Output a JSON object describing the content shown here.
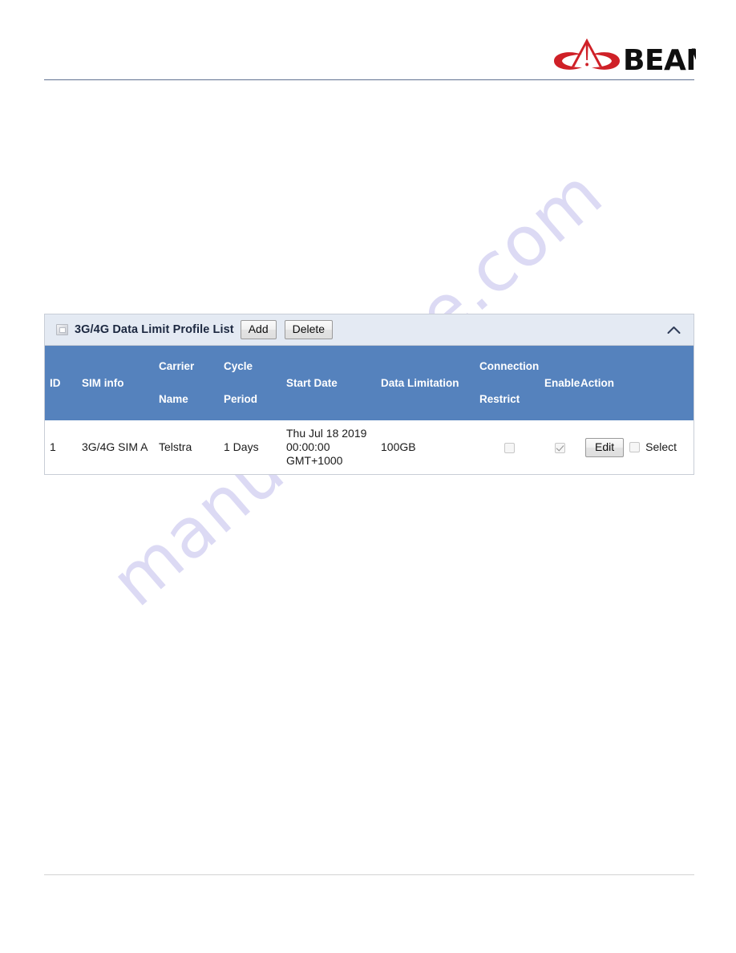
{
  "header": {
    "logo_text": "BEAM",
    "logo_mark": "beam-antenna-icon",
    "logo_trademark": "®"
  },
  "watermark": {
    "text": "manualshive.com"
  },
  "panel": {
    "icon": "minimize-box-icon",
    "title": "3G/4G Data Limit Profile List",
    "add_label": "Add",
    "delete_label": "Delete",
    "collapse_icon": "chevron-up-icon",
    "header_bg": "#e4eaf3",
    "table_header_bg": "#5582bd"
  },
  "table": {
    "columns": [
      {
        "id": "id",
        "label": "ID",
        "line1": "ID",
        "line2": ""
      },
      {
        "id": "sim_info",
        "label": "SIM info",
        "line1": "SIM info",
        "line2": ""
      },
      {
        "id": "carrier_name",
        "label": "Carrier Name",
        "line1": "Carrier",
        "line2": "Name"
      },
      {
        "id": "cycle_period",
        "label": "Cycle Period",
        "line1": "Cycle",
        "line2": "Period"
      },
      {
        "id": "start_date",
        "label": "Start Date",
        "line1": "Start Date",
        "line2": ""
      },
      {
        "id": "data_limitation",
        "label": "Data Limitation",
        "line1": "Data Limitation",
        "line2": ""
      },
      {
        "id": "connection_restrict",
        "label": "Connection Restrict",
        "line1": "Connection",
        "line2": "Restrict"
      },
      {
        "id": "enable",
        "label": "Enable",
        "line1": "Enable",
        "line2": ""
      },
      {
        "id": "action",
        "label": "Action",
        "line1": "Action",
        "line2": ""
      }
    ],
    "rows": [
      {
        "id": "1",
        "sim_info": "3G/4G SIM A",
        "carrier_name": "Telstra",
        "cycle_period": "1 Days",
        "start_date_line1": "Thu Jul 18 2019",
        "start_date_line2": "00:00:00",
        "start_date_line3": "GMT+1000",
        "data_limitation": "100GB",
        "connection_restrict_checked": false,
        "enable_checked": true,
        "edit_label": "Edit",
        "select_label": "Select",
        "select_checked": false
      }
    ]
  }
}
